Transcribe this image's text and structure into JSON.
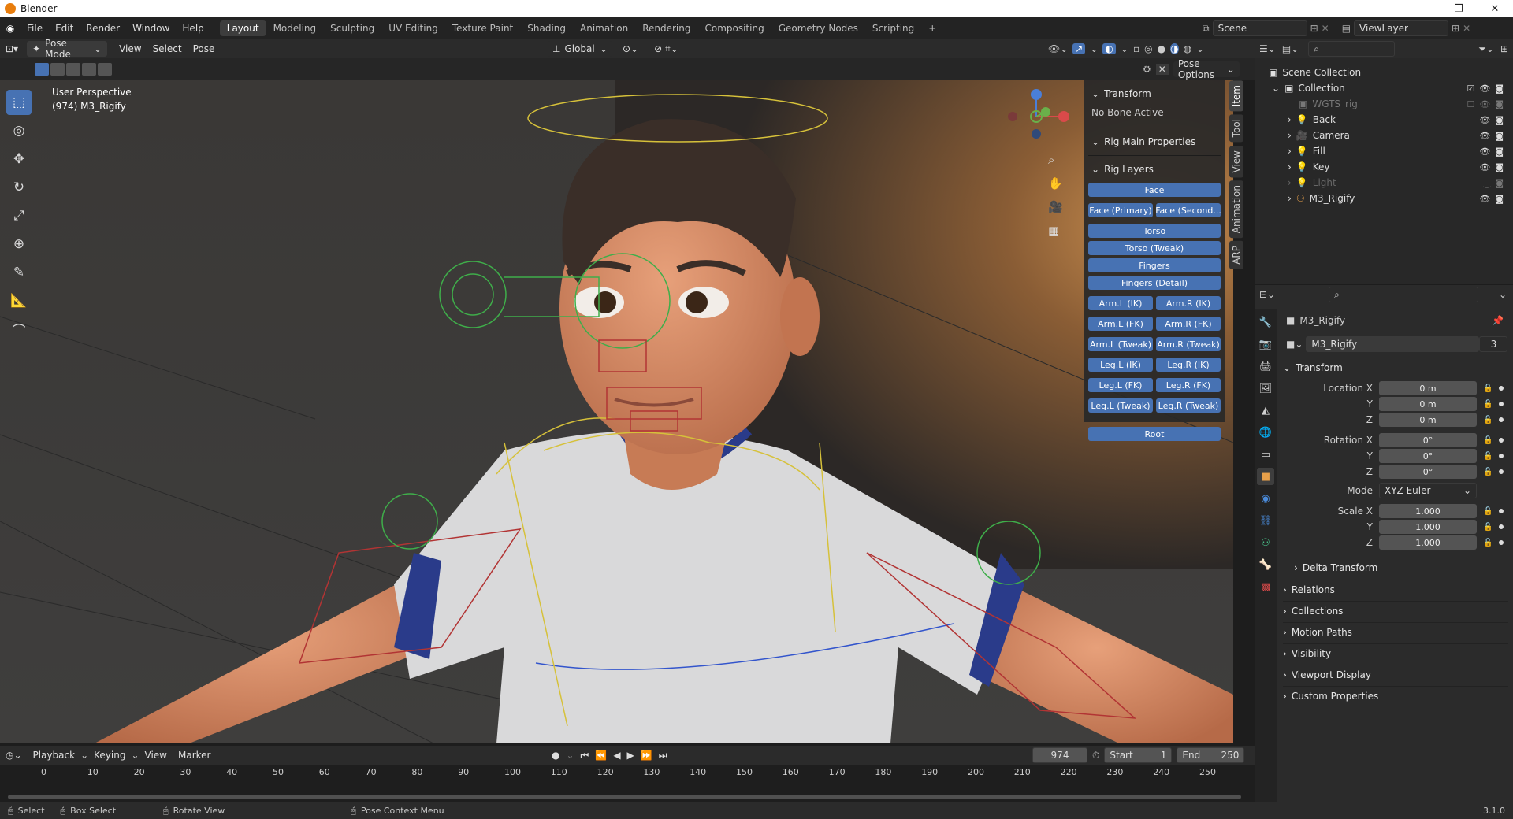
{
  "window": {
    "title": "Blender"
  },
  "menu": [
    "File",
    "Edit",
    "Render",
    "Window",
    "Help"
  ],
  "workspaces": [
    "Layout",
    "Modeling",
    "Sculpting",
    "UV Editing",
    "Texture Paint",
    "Shading",
    "Animation",
    "Rendering",
    "Compositing",
    "Geometry Nodes",
    "Scripting"
  ],
  "workspace_add": "+",
  "scene": "Scene",
  "view_layer": "ViewLayer",
  "vp_header": {
    "mode": "Pose Mode",
    "menus": [
      "View",
      "Select",
      "Pose"
    ],
    "orientation": "Global",
    "pose_options": "Pose Options"
  },
  "vp_info": {
    "perspective": "User Perspective",
    "object": "(974) M3_Rigify"
  },
  "npanel": {
    "transform": "Transform",
    "no_bone": "No Bone Active",
    "rig_main": "Rig Main Properties",
    "rig_layers": "Rig Layers",
    "buttons": {
      "face": "Face",
      "face_primary": "Face (Primary)",
      "face_secondary": "Face (Second...",
      "torso": "Torso",
      "torso_tweak": "Torso (Tweak)",
      "fingers": "Fingers",
      "fingers_detail": "Fingers (Detail)",
      "arm_l_ik": "Arm.L (IK)",
      "arm_r_ik": "Arm.R (IK)",
      "arm_l_fk": "Arm.L (FK)",
      "arm_r_fk": "Arm.R (FK)",
      "arm_l_tweak": "Arm.L (Tweak)",
      "arm_r_tweak": "Arm.R (Tweak)",
      "leg_l_ik": "Leg.L (IK)",
      "leg_r_ik": "Leg.R (IK)",
      "leg_l_fk": "Leg.L (FK)",
      "leg_r_fk": "Leg.R (FK)",
      "leg_l_tweak": "Leg.L (Tweak)",
      "leg_r_tweak": "Leg.R (Tweak)",
      "root": "Root"
    },
    "tabs": [
      "Item",
      "Tool",
      "View",
      "Animation",
      "ARP"
    ]
  },
  "outliner": {
    "scene_collection": "Scene Collection",
    "collection": "Collection",
    "items": [
      "WGTS_rig",
      "Back",
      "Camera",
      "Fill",
      "Key",
      "Light",
      "M3_Rigify"
    ]
  },
  "properties": {
    "object_name": "M3_Rigify",
    "data_name": "M3_Rigify",
    "data_users": "3",
    "transform": "Transform",
    "location_x_label": "Location X",
    "location_x": "0 m",
    "location_y_label": "Y",
    "location_y": "0 m",
    "location_z_label": "Z",
    "location_z": "0 m",
    "rotation_x_label": "Rotation X",
    "rotation_x": "0°",
    "rotation_y_label": "Y",
    "rotation_y": "0°",
    "rotation_z_label": "Z",
    "rotation_z": "0°",
    "mode_label": "Mode",
    "mode": "XYZ Euler",
    "scale_x_label": "Scale X",
    "scale_x": "1.000",
    "scale_y_label": "Y",
    "scale_y": "1.000",
    "scale_z_label": "Z",
    "scale_z": "1.000",
    "delta": "Delta Transform",
    "sections": [
      "Relations",
      "Collections",
      "Motion Paths",
      "Visibility",
      "Viewport Display",
      "Custom Properties"
    ]
  },
  "timeline": {
    "menus": [
      "Playback",
      "Keying",
      "View",
      "Marker"
    ],
    "current_frame": "974",
    "start_label": "Start",
    "start": "1",
    "end_label": "End",
    "end": "250",
    "ticks": [
      "0",
      "10",
      "20",
      "30",
      "40",
      "50",
      "60",
      "70",
      "80",
      "90",
      "100",
      "110",
      "120",
      "130",
      "140",
      "150",
      "160",
      "170",
      "180",
      "190",
      "200",
      "210",
      "220",
      "230",
      "240",
      "250"
    ]
  },
  "status": {
    "select": "Select",
    "box_select": "Box Select",
    "rotate": "Rotate View",
    "context": "Pose Context Menu",
    "version": "3.1.0"
  }
}
